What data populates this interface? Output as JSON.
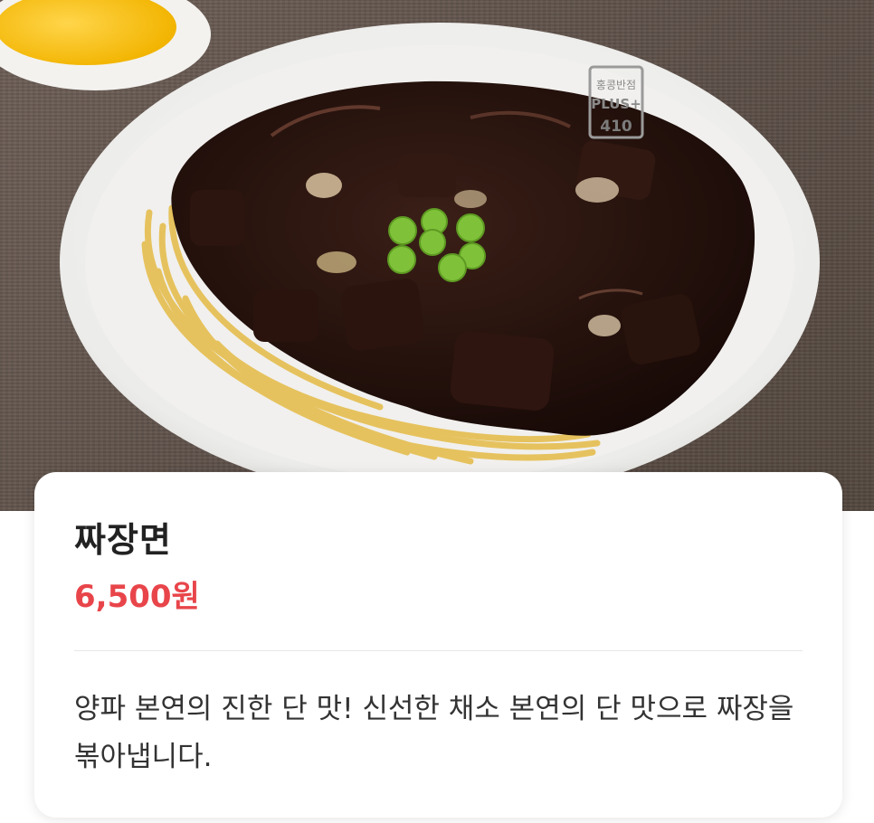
{
  "menu": {
    "name": "짜장면",
    "price": "6,500원",
    "description": "양파 본연의 진한 단 맛! 신선한 채소 본연의 단 맛으로 짜장을 볶아냅니다."
  },
  "image": {
    "bowl_logo_line1": "홍콩반점",
    "bowl_logo_line2": "PLUS+",
    "bowl_logo_line3": "410"
  },
  "colors": {
    "price": "#e8454a",
    "text": "#222222",
    "card": "#ffffff"
  }
}
